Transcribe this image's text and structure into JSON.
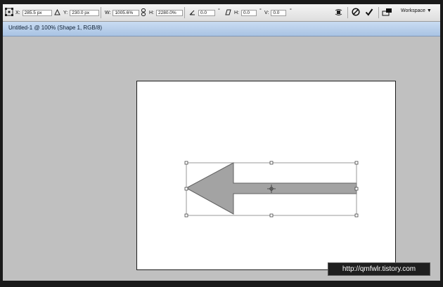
{
  "options_bar": {
    "x_label": "X:",
    "x_value": "285.5 px",
    "y_label": "Y:",
    "y_value": "230.0 px",
    "w_label": "W:",
    "w_value": "1005.6%",
    "h_label": "H:",
    "h_value": "2280.0%",
    "rotate_value": "0.0",
    "rotate_unit": "°",
    "h_skew_label": "H:",
    "h_skew_value": "0.0",
    "h_skew_unit": "°",
    "v_skew_label": "V:",
    "v_skew_value": "0.0",
    "v_skew_unit": "°",
    "workspace_label": "Workspace"
  },
  "document": {
    "tab_title": "Untitled-1 @ 100% (Shape 1, RGB/8)"
  },
  "watermark": {
    "text": "http://qmfwlr.tistory.com"
  },
  "colors": {
    "shape_fill": "#a3a3a3",
    "canvas_bg": "#c0c0c0",
    "tab_bar": "#b8cfea"
  }
}
